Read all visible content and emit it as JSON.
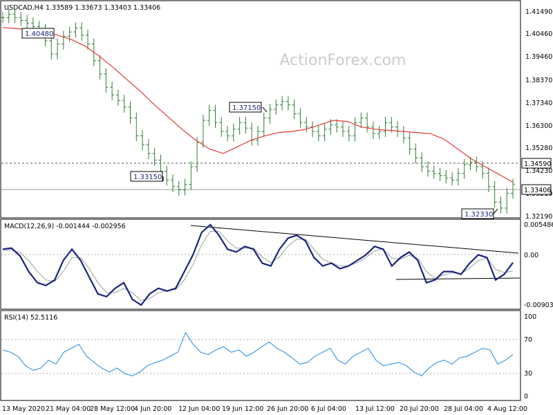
{
  "watermark": "ActionForex.com",
  "colors": {
    "background": "#ffffff",
    "price_bar": "#2e7d32",
    "moving_average": "#e53935",
    "macd_line": "#1a237e",
    "signal_line": "#9e9e9e",
    "rsi_line": "#1e88e5",
    "level_line": "#555555",
    "current_price_line": "#999999",
    "frame": "#000000",
    "watermark": "#cccccc"
  },
  "chart_data": [
    {
      "type": "ohlc",
      "title": "USDCAD,H4  1.33589 1.33673 1.33403 1.33406",
      "x_tick_labels": [
        "13 May 2020",
        "21 May 04:00",
        "28 May 12:00",
        "4 Jun 20:00",
        "12 Jun 04:00",
        "19 Jun 12:00",
        "26 Jun 20:00",
        "6 Jul 04:00",
        "13 Jul 12:00",
        "20 Jul 20:00",
        "28 Jul 04:00",
        "4 Aug 12:00"
      ],
      "y_tick_labels": [
        "1.41490",
        "1.40460",
        "1.39460",
        "1.38370",
        "1.37340",
        "1.36300",
        "1.35280",
        "1.34230",
        "1.33210",
        "1.32190"
      ],
      "ylim": [
        1.3195,
        1.4165
      ],
      "series": [
        {
          "name": "USDCAD,H4",
          "values": [
            1.4095,
            1.411,
            1.4095,
            1.4082,
            1.407,
            1.4055,
            1.404,
            1.399,
            1.393,
            1.3975,
            1.401,
            1.403,
            1.4048,
            1.4015,
            1.3975,
            1.39,
            1.384,
            1.378,
            1.3745,
            1.372,
            1.369,
            1.364,
            1.356,
            1.352,
            1.348,
            1.345,
            1.34,
            1.336,
            1.333,
            1.3315,
            1.334,
            1.342,
            1.353,
            1.363,
            1.3675,
            1.362,
            1.358,
            1.356,
            1.359,
            1.362,
            1.3595,
            1.354,
            1.358,
            1.364,
            1.368,
            1.37,
            1.3715,
            1.37,
            1.366,
            1.362,
            1.36,
            1.358,
            1.356,
            1.359,
            1.361,
            1.36,
            1.358,
            1.356,
            1.362,
            1.364,
            1.36,
            1.357,
            1.358,
            1.362,
            1.36,
            1.358,
            1.355,
            1.35,
            1.346,
            1.342,
            1.34,
            1.339,
            1.338,
            1.337,
            1.336,
            1.339,
            1.343,
            1.344,
            1.342,
            1.339,
            1.333,
            1.326,
            1.3233,
            1.33,
            1.3341
          ]
        },
        {
          "name": "moving average",
          "values": [
            1.405,
            1.4045,
            1.404,
            1.403,
            1.4015,
            1.3995,
            1.3965,
            1.392,
            1.387,
            1.3815,
            1.376,
            1.37,
            1.3645,
            1.359,
            1.354,
            1.35,
            1.348,
            1.351,
            1.354,
            1.356,
            1.3575,
            1.358,
            1.359,
            1.361,
            1.363,
            1.3625,
            1.36,
            1.359,
            1.3585,
            1.358,
            1.3575,
            1.357,
            1.3545,
            1.35,
            1.3455,
            1.342,
            1.3385,
            1.335
          ]
        }
      ],
      "levels": [
        {
          "label": "1.34590",
          "value": 1.3459
        },
        {
          "label": "1.33406",
          "value": 1.33406
        }
      ],
      "annotations": [
        "1.40480",
        "1.37150",
        "1.33150",
        "1.32330"
      ]
    },
    {
      "type": "line",
      "title": "MACD(12,26,9) -0.001444 -0.002956",
      "y_tick_labels": [
        "0.005486",
        "0.00",
        "-0.009034"
      ],
      "ylim": [
        -0.0095,
        0.006
      ],
      "series": [
        {
          "name": "MACD(12,26,9)",
          "values": [
            0.001,
            0.0012,
            -0.0002,
            -0.003,
            -0.005,
            -0.0055,
            -0.0045,
            -0.001,
            0.001,
            -0.001,
            -0.004,
            -0.007,
            -0.0075,
            -0.006,
            -0.005,
            -0.008,
            -0.009,
            -0.007,
            -0.006,
            -0.0065,
            -0.006,
            -0.003,
            0.0,
            0.004,
            0.0054,
            0.0035,
            0.001,
            0.0005,
            0.0015,
            0.001,
            -0.0015,
            -0.002,
            0.001,
            0.003,
            0.0035,
            0.0025,
            -0.0005,
            -0.002,
            -0.0015,
            -0.0025,
            -0.002,
            -0.001,
            0.0,
            0.0015,
            0.001,
            -0.002,
            -0.0005,
            0.0005,
            -0.001,
            -0.005,
            -0.0045,
            -0.003,
            -0.003,
            -0.0035,
            -0.0015,
            0.0,
            -0.0005,
            -0.0045,
            -0.0035,
            -0.0014
          ]
        },
        {
          "name": "signal",
          "values": [
            0.0008,
            0.0009,
            0.0004,
            -0.001,
            -0.003,
            -0.0045,
            -0.0048,
            -0.003,
            -0.0005,
            -0.0005,
            -0.0025,
            -0.005,
            -0.0068,
            -0.0068,
            -0.006,
            -0.0068,
            -0.0082,
            -0.0078,
            -0.0068,
            -0.0064,
            -0.0062,
            -0.0045,
            -0.0018,
            0.0018,
            0.0042,
            0.0042,
            0.0025,
            0.0012,
            0.0012,
            0.0012,
            -0.0004,
            -0.0014,
            -0.0004,
            0.0016,
            0.0028,
            0.0028,
            0.001,
            -0.0008,
            -0.0014,
            -0.002,
            -0.002,
            -0.0014,
            -0.0005,
            0.0007,
            0.001,
            -0.0006,
            -0.0008,
            -0.0001,
            -0.0006,
            -0.003,
            -0.0042,
            -0.0036,
            -0.0032,
            -0.0034,
            -0.0024,
            -0.001,
            -0.0006,
            -0.0026,
            -0.0032,
            -0.0029
          ]
        }
      ]
    },
    {
      "type": "line",
      "title": "RSI(14) 52.5116",
      "y_tick_labels": [
        "100",
        "70",
        "30",
        "0"
      ],
      "ylim": [
        0,
        100
      ],
      "series": [
        {
          "name": "RSI(14)",
          "values": [
            58,
            55,
            50,
            38,
            32,
            35,
            45,
            40,
            55,
            60,
            65,
            50,
            42,
            35,
            30,
            35,
            28,
            25,
            30,
            38,
            42,
            45,
            50,
            55,
            80,
            65,
            55,
            52,
            58,
            62,
            55,
            58,
            50,
            55,
            62,
            68,
            60,
            55,
            48,
            40,
            42,
            50,
            55,
            60,
            45,
            40,
            50,
            55,
            60,
            45,
            38,
            40,
            42,
            38,
            30,
            25,
            35,
            42,
            45,
            40,
            48,
            50,
            55,
            60,
            58,
            40,
            45,
            52
          ]
        }
      ]
    }
  ]
}
